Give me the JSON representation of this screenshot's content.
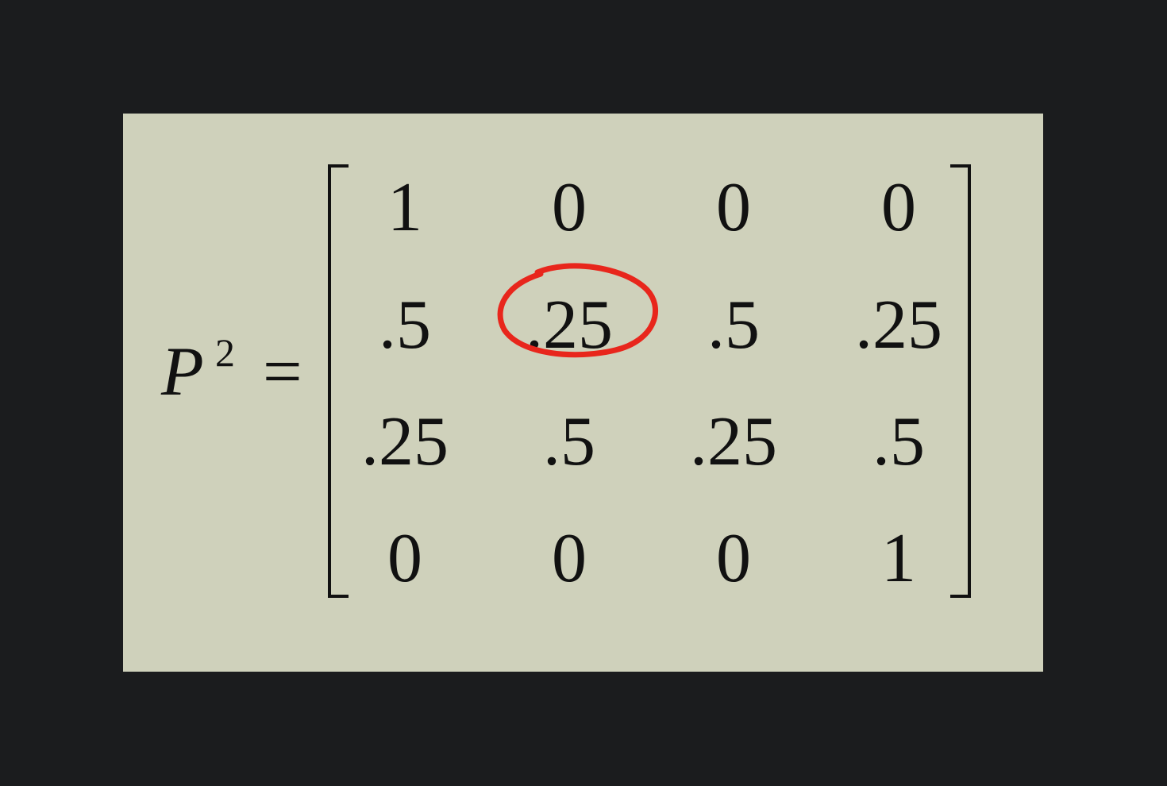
{
  "equation": {
    "variable": "P",
    "exponent": "2",
    "equals": "="
  },
  "matrix": {
    "rows": [
      [
        "1",
        "0",
        "0",
        "0"
      ],
      [
        ".5",
        ".25",
        ".5",
        ".25"
      ],
      [
        ".25",
        ".5",
        ".25",
        ".5"
      ],
      [
        "0",
        "0",
        "0",
        "1"
      ]
    ],
    "highlighted_cell": {
      "row": 2,
      "column": 2,
      "value": ".25"
    }
  },
  "colors": {
    "background": "#1b1c1e",
    "slide": "#cfd1bb",
    "text": "#111111",
    "highlight": "#e8261c"
  }
}
